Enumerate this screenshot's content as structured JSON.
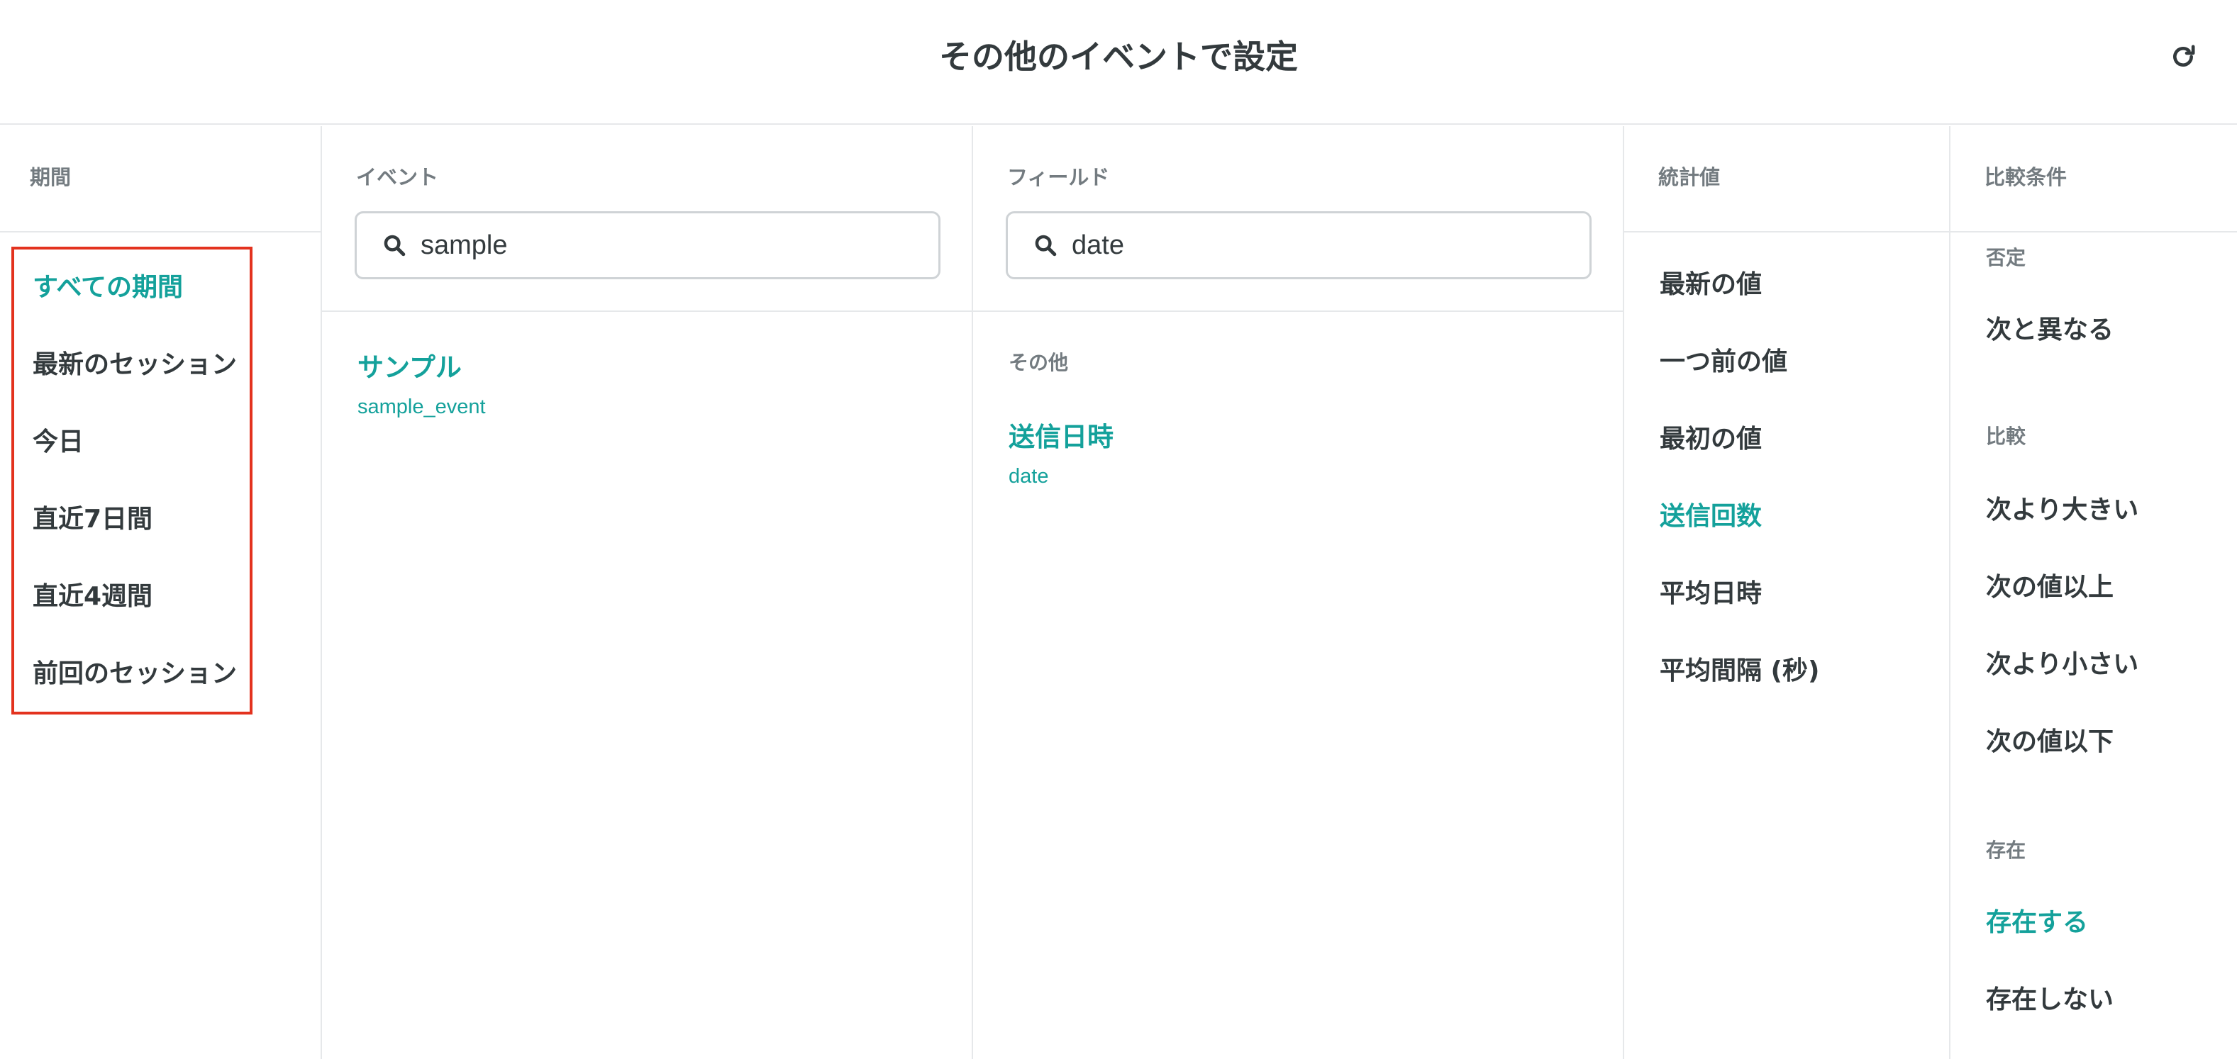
{
  "header": {
    "title": "その他のイベントで設定",
    "refresh_icon": "refresh-icon"
  },
  "colors": {
    "accent": "#14a19b",
    "text": "#333a3d",
    "muted": "#737b80",
    "highlight_border": "#e3321e",
    "divider": "#e6e8ea"
  },
  "period": {
    "label": "期間",
    "items": [
      {
        "label": "すべての期間",
        "active": true
      },
      {
        "label": "最新のセッション",
        "active": false
      },
      {
        "label": "今日",
        "active": false
      },
      {
        "label": "直近7日間",
        "active": false
      },
      {
        "label": "直近4週間",
        "active": false
      },
      {
        "label": "前回のセッション",
        "active": false
      }
    ]
  },
  "event": {
    "label": "イベント",
    "search_value": "sample",
    "results": [
      {
        "name": "サンプル",
        "id": "sample_event"
      }
    ]
  },
  "field": {
    "label": "フィールド",
    "search_value": "date",
    "group_label": "その他",
    "results": [
      {
        "name": "送信日時",
        "id": "date"
      }
    ]
  },
  "stat": {
    "label": "統計値",
    "items": [
      {
        "label": "最新の値",
        "active": false
      },
      {
        "label": "一つ前の値",
        "active": false
      },
      {
        "label": "最初の値",
        "active": false
      },
      {
        "label": "送信回数",
        "active": true
      },
      {
        "label": "平均日時",
        "active": false
      },
      {
        "label": "平均間隔 (秒)",
        "active": false
      }
    ]
  },
  "compare": {
    "label": "比較条件",
    "groups": [
      {
        "label": "否定",
        "items": [
          {
            "label": "次と異なる",
            "active": false
          }
        ]
      },
      {
        "label": "比較",
        "items": [
          {
            "label": "次より大きい",
            "active": false
          },
          {
            "label": "次の値以上",
            "active": false
          },
          {
            "label": "次より小さい",
            "active": false
          },
          {
            "label": "次の値以下",
            "active": false
          }
        ]
      },
      {
        "label": "存在",
        "items": [
          {
            "label": "存在する",
            "active": true
          },
          {
            "label": "存在しない",
            "active": false
          }
        ]
      }
    ]
  }
}
